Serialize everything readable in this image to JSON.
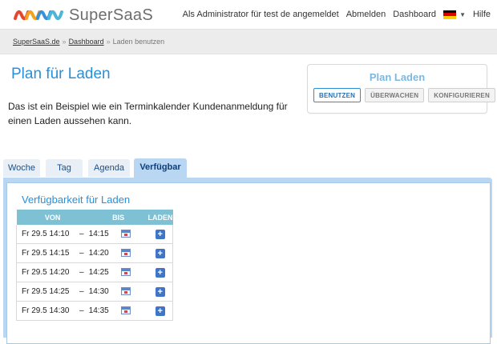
{
  "brand": {
    "name": "SuperSaaS",
    "logo_colors": [
      "#e8452f",
      "#f4a21d",
      "#3b8fd6",
      "#4cb6d6"
    ]
  },
  "topnav": {
    "logged_in_text": "Als Administrator für test de angemeldet",
    "logout": "Abmelden",
    "dashboard": "Dashboard",
    "flag_icon": "german-flag-icon",
    "help": "Hilfe"
  },
  "breadcrumb": {
    "home": "SuperSaaS.de",
    "dashboard": "Dashboard",
    "current": "Laden benutzen"
  },
  "page": {
    "title": "Plan für Laden",
    "intro": "Das ist ein Beispiel wie ein Terminkalender Kundenanmeldung für einen Laden aussehen kann."
  },
  "plan_panel": {
    "title": "Plan Laden",
    "buttons": [
      "BENUTZEN",
      "ÜBERWACHEN",
      "KONFIGURIEREN"
    ],
    "active_button": "BENUTZEN"
  },
  "tabs": [
    {
      "label": "Woche",
      "active": false
    },
    {
      "label": "Tag",
      "active": false
    },
    {
      "label": "Agenda",
      "active": false
    },
    {
      "label": "Verfügbar",
      "active": true
    }
  ],
  "availability": {
    "title": "Verfügbarkeit für Laden",
    "columns": [
      "VON",
      "BIS",
      "LADEN"
    ],
    "rows": [
      {
        "von": "Fr 29.5 14:10",
        "bis": "14:15"
      },
      {
        "von": "Fr 29.5 14:15",
        "bis": "14:20"
      },
      {
        "von": "Fr 29.5 14:20",
        "bis": "14:25"
      },
      {
        "von": "Fr 29.5 14:25",
        "bis": "14:30"
      },
      {
        "von": "Fr 29.5 14:30",
        "bis": "14:35"
      }
    ],
    "dash": "–",
    "icons": {
      "calendar": "calendar-icon",
      "add": "add-icon"
    }
  },
  "colors": {
    "accent_blue": "#2a8fd7",
    "tab_active_bg": "#b9d6f2",
    "table_header_bg": "#7ec0d4"
  }
}
